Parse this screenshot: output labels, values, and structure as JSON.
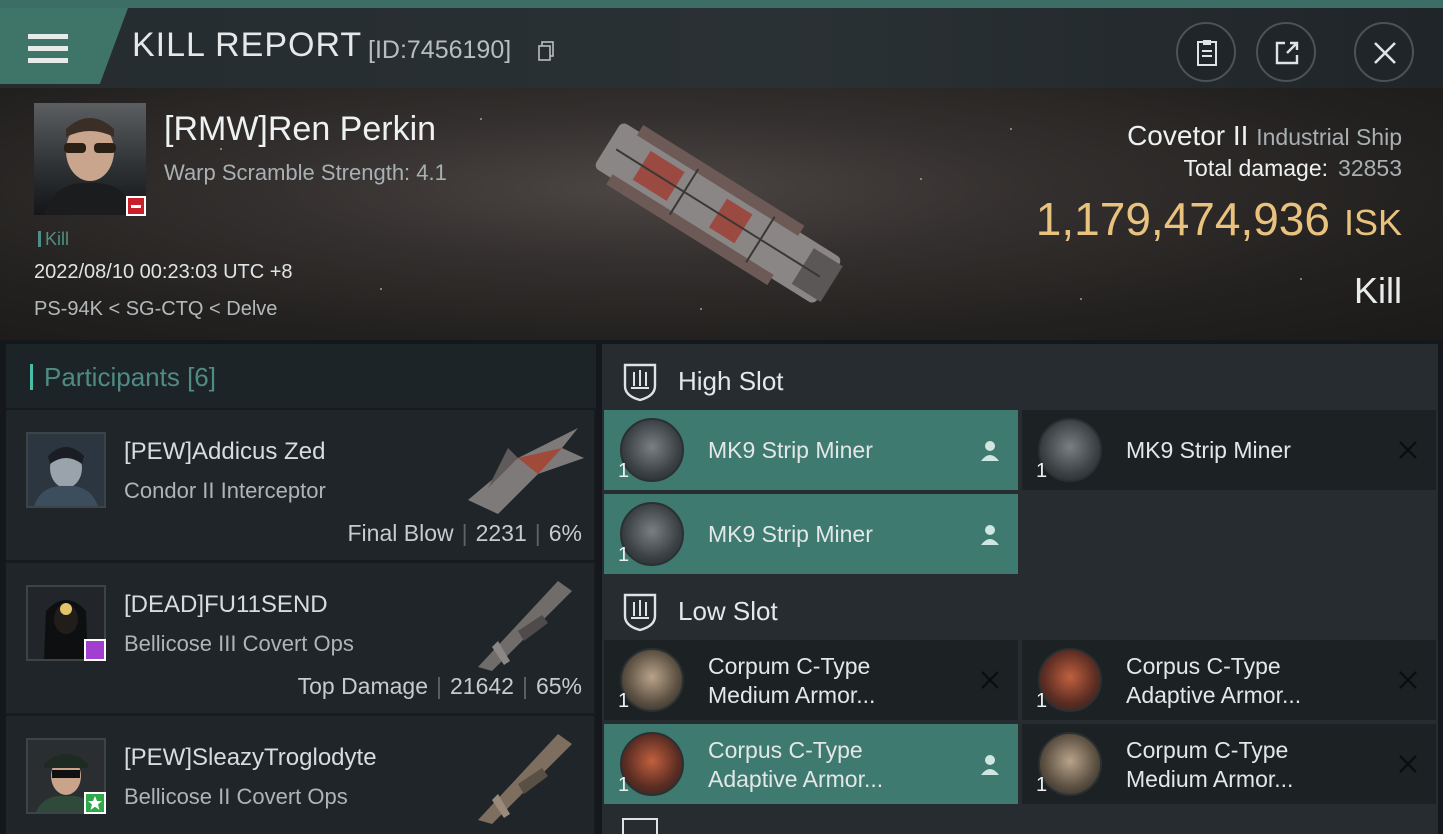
{
  "header": {
    "title": "KILL REPORT",
    "id_text": "[ID:7456190]",
    "buttons": [
      "clipboard-icon",
      "share-icon",
      "close-icon"
    ]
  },
  "victim": {
    "name": "[RMW]Ren Perkin",
    "warp_scramble": "Warp Scramble Strength: 4.1",
    "kill_tag": "Kill",
    "datetime": "2022/08/10 00:23:03 UTC +8",
    "location": "PS-94K < SG-CTQ < Delve",
    "ship": "Covetor II",
    "ship_class": "Industrial Ship",
    "damage_label": "Total damage:",
    "damage_value": "32853",
    "isk_value": "1,179,474,936",
    "isk_unit": "ISK",
    "result": "Kill"
  },
  "participants": {
    "title": "Participants [6]",
    "items": [
      {
        "name": "[PEW]Addicus Zed",
        "ship": "Condor II Interceptor",
        "role": "Final Blow",
        "damage": "2231",
        "percent": "6%"
      },
      {
        "name": "[DEAD]FU11SEND",
        "ship": "Bellicose III Covert Ops",
        "role": "Top Damage",
        "damage": "21642",
        "percent": "65%"
      },
      {
        "name": "[PEW]SleazyTroglodyte",
        "ship": "Bellicose II Covert Ops"
      }
    ]
  },
  "slots": {
    "high_label": "High Slot",
    "low_label": "Low Slot",
    "high": [
      {
        "qty": "1",
        "name": "MK9 Strip Miner",
        "status": "dropped"
      },
      {
        "qty": "1",
        "name": "MK9 Strip Miner",
        "status": "destroyed"
      },
      {
        "qty": "1",
        "name": "MK9 Strip Miner",
        "status": "dropped"
      }
    ],
    "low": [
      {
        "qty": "1",
        "line1": "Corpum C-Type",
        "line2": "Medium Armor...",
        "status": "destroyed"
      },
      {
        "qty": "1",
        "line1": "Corpus C-Type",
        "line2": "Adaptive Armor...",
        "status": "destroyed"
      },
      {
        "qty": "1",
        "line1": "Corpus C-Type",
        "line2": "Adaptive Armor...",
        "status": "dropped"
      },
      {
        "qty": "1",
        "line1": "Corpum C-Type",
        "line2": "Medium Armor...",
        "status": "destroyed"
      }
    ]
  },
  "colors": {
    "accent": "#3e7a70",
    "isk": "#e9c27e",
    "badge_red": "#c8202b",
    "badge_purple": "#a23fd0",
    "badge_green": "#2fa84a"
  }
}
